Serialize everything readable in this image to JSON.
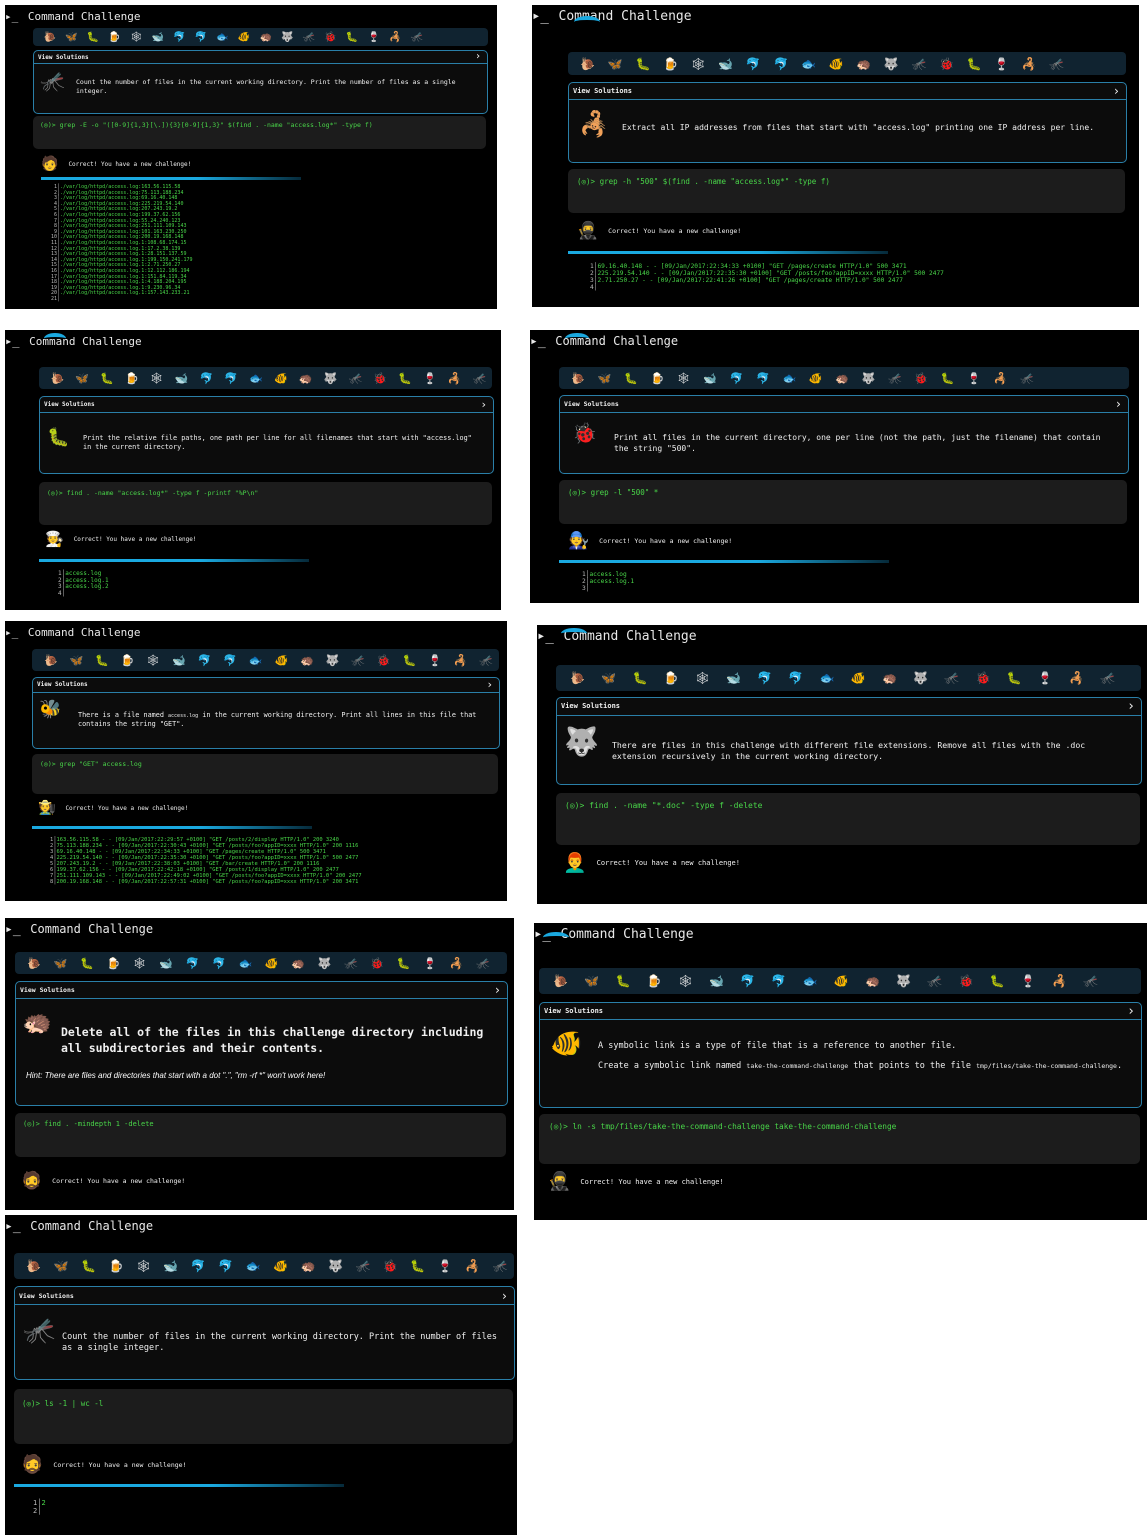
{
  "app_title": "Command Challenge",
  "view_solutions": "View Solutions",
  "chevron": "›",
  "prompt_glyph": "▸_",
  "prompt_prefix": "(◎)> ",
  "success_message": "Correct! You have a new challenge!",
  "accent_color": "#1aa9e0",
  "command_color": "#49d649",
  "icon_bar": [
    "🐌",
    "🦋",
    "🐛",
    "🍺",
    "🕸",
    "🐋",
    "🐬",
    "🐬",
    "🐟",
    "🐠",
    "🦔",
    "🐺",
    "🦟",
    "🐞",
    "🐛",
    "🍷",
    "🦂",
    "🦟"
  ],
  "panels": [
    {
      "id": "p1",
      "animal_icon": "🦟",
      "description": "Count the number of files in the current working directory. Print the number of files as a single integer.",
      "command": "grep -E -o \"([0-9]{1,3}[\\.]){3}[0-9]{1,3}\" $(find . -name \"access.log*\" -type f)",
      "avatar": "🧑",
      "output": [
        "./var/log/httpd/access.log:163.56.115.58",
        "./var/log/httpd/access.log:75.113.188.234",
        "./var/log/httpd/access.log:69.16.40.148",
        "./var/log/httpd/access.log:225.219.54.140",
        "./var/log/httpd/access.log:207.243.19.2",
        "./var/log/httpd/access.log:199.37.62.156",
        "./var/log/httpd/access.log:55.24.240.123",
        "./var/log/httpd/access.log:251.111.109.143",
        "./var/log/httpd/access.log:101.163.230.250",
        "./var/log/httpd/access.log:200.19.168.148",
        "./var/log/httpd/access.log.1:108.68.174.15",
        "./var/log/httpd/access.log.1:17.2.38.139",
        "./var/log/httpd/access.log.1:28.151.137.59",
        "./var/log/httpd/access.log.1:199.150.241.179",
        "./var/log/httpd/access.log.1:2.71.250.27",
        "./var/log/httpd/access.log.1:12.112.186.194",
        "./var/log/httpd/access.log.1:151.84.119.34",
        "./var/log/httpd/access.log.1:4.188.204.195",
        "./var/log/httpd/access.log.1:9.230.96.34",
        "./var/log/httpd/access.log.1:157.143.233.21",
        ""
      ]
    },
    {
      "id": "p2",
      "animal_icon": "🦂",
      "description": "Extract all IP addresses from files that start with \"access.log\" printing one IP address per line.",
      "command": "grep -h \"500\" $(find . -name \"access.log*\" -type f)",
      "avatar": "🥷",
      "output": [
        "69.16.40.148 - - [09/Jan/2017:22:34:33 +0100] \"GET /pages/create HTTP/1.0\" 500 3471",
        "225.219.54.140 - - [09/Jan/2017:22:35:30 +0100] \"GET /posts/foo?appID=xxxx HTTP/1.0\" 500 2477",
        "2.71.250.27 - - [09/Jan/2017:22:41:26 +0100] \"GET /pages/create HTTP/1.0\" 500 2477",
        ""
      ]
    },
    {
      "id": "p3",
      "animal_icon": "🐛",
      "description": "Print the relative file paths, one path per line for all filenames that start with \"access.log\" in the current directory.",
      "command": "find . -name \"access.log*\" -type f -printf \"%P\\n\"",
      "avatar": "🧑‍🍳",
      "output": [
        "access.log",
        "access.log.1",
        "access.log.2",
        ""
      ]
    },
    {
      "id": "p4",
      "animal_icon": "🐞",
      "description": "Print all files in the current directory, one per line (not the path, just the filename) that contain the string \"500\".",
      "command": "grep -l \"500\" *",
      "avatar": "🧑‍🔧",
      "output": [
        "access.log",
        "access.log.1",
        ""
      ]
    },
    {
      "id": "p5",
      "animal_icon": "🐝",
      "description_parts": [
        "There is a file named ",
        "access.log",
        " in the current working directory. Print all lines in this file that contains the string \"GET\"."
      ],
      "command": "grep \"GET\" access.log",
      "avatar": "🧑‍🌾",
      "output": [
        "163.56.115.58 - - [09/Jan/2017:22:29:57 +0100] \"GET /posts/2/display HTTP/1.0\" 200 3240",
        "75.113.188.234 - - [09/Jan/2017:22:30:43 +0100] \"GET /posts/foo?appID=xxxx HTTP/1.0\" 200 1116",
        "69.16.40.148 - - [09/Jan/2017:22:34:33 +0100] \"GET /pages/create HTTP/1.0\" 500 3471",
        "225.219.54.140 - - [09/Jan/2017:22:35:30 +0100] \"GET /posts/foo?appID=xxxx HTTP/1.0\" 500 2477",
        "207.243.19.2 - - [09/Jan/2017:22:38:03 +0100] \"GET /bar/create HTTP/1.0\" 200 1116",
        "199.37.62.156 - - [09/Jan/2017:22:42:18 +0100] \"GET /posts/1/display HTTP/1.0\" 200 2477",
        "251.111.109.143 - - [09/Jan/2017:22:49:02 +0100] \"GET /posts/foo?appID=xxxx HTTP/1.0\" 200 2477",
        "200.19.168.148 - - [09/Jan/2017:22:57:31 +0100] \"GET /posts/foo?appID=xxxx HTTP/1.0\" 200 3471"
      ]
    },
    {
      "id": "p6",
      "animal_icon": "🐺",
      "description": "There are files in this challenge with different file extensions. Remove all files with the .doc extension recursively in the current working directory.",
      "command": "find . -name \"*.doc\" -type f -delete",
      "avatar": "👨‍🦰",
      "output": []
    },
    {
      "id": "p7",
      "animal_icon": "🦔",
      "description": "Delete all of the files in this challenge directory including all subdirectories and their contents.",
      "hint": "Hint: There are files and directories that start with a dot \".\", \"rm -rf *\" won't work here!",
      "command": "find . -mindepth 1 -delete",
      "avatar": "🧔",
      "output": []
    },
    {
      "id": "p8",
      "animal_icon": "🐠",
      "description": "A symbolic link is a type of file that is a reference to another file.",
      "description2_parts": [
        "Create a symbolic link named ",
        "take-the-command-challenge",
        " that points to the file ",
        "tmp/files/take-the-command-challenge",
        "."
      ],
      "command": "ln -s tmp/files/take-the-command-challenge take-the-command-challenge",
      "avatar": "🥷",
      "output": []
    },
    {
      "id": "p9",
      "animal_icon": "🦟",
      "description": "Count the number of files in the current working directory. Print the number of files as a single integer.",
      "command": "ls -1 | wc -l",
      "avatar": "🧔",
      "output": [
        "2",
        ""
      ]
    }
  ]
}
